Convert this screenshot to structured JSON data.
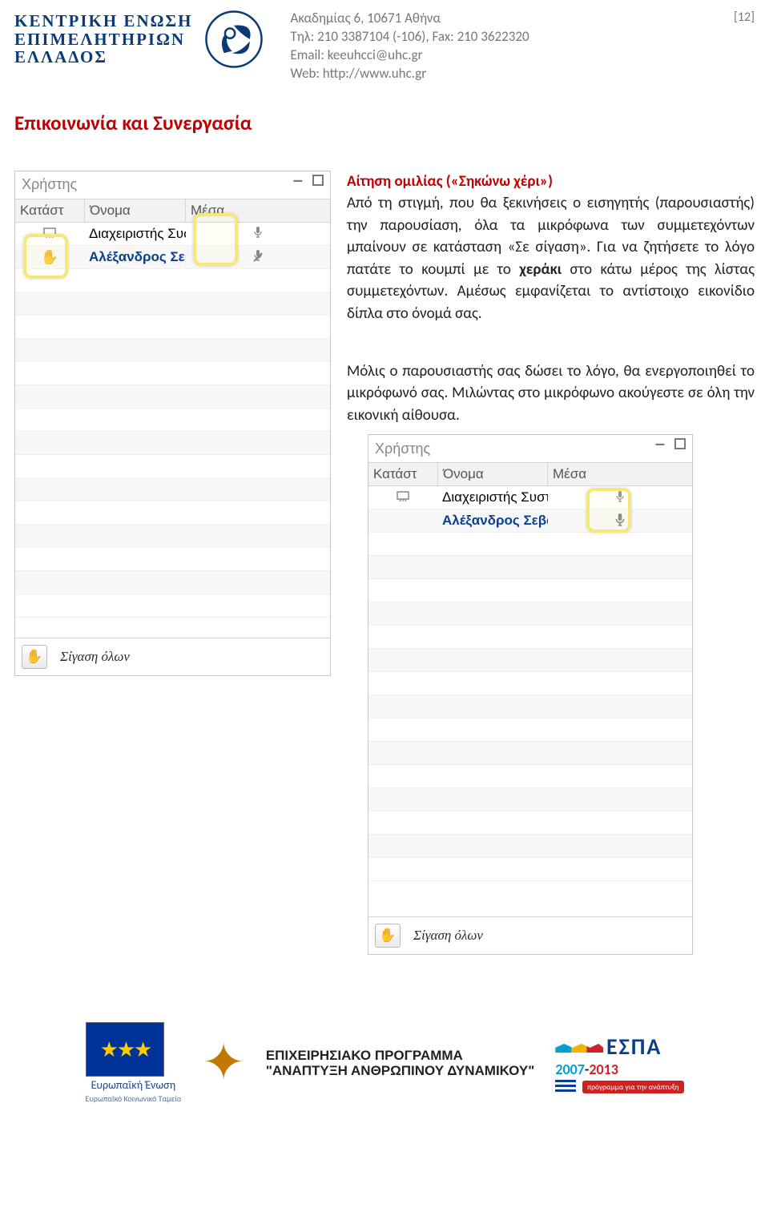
{
  "meta": {
    "page_number_label": "[12]"
  },
  "org": {
    "name_line1": "ΚΕΝΤΡΙΚΗ ΕΝΩΣΗ",
    "name_line2": "ΕΠΙΜΕΛΗΤΗΡΙΩΝ",
    "name_line3": "ΕΛΛΑΔΟΣ",
    "address": "Ακαδημίας 6, 10671 Αθήνα",
    "phone_fax": "Τηλ: 210 3387104 (-106), Fax: 210 3622320",
    "email": "Email: keeuhcci@uhc.gr",
    "web": "Web: http://www.uhc.gr"
  },
  "section_title": "Επικοινωνία και Συνεργασία",
  "content_title": "Αίτηση ομιλίας («Σηκώνω χέρι»)",
  "paragraph1_a": "Από τη στιγμή, που θα ξεκινήσεις ο εισηγητής (παρουσιαστής) την παρουσίαση, όλα τα μικρόφωνα των συμμετεχόντων μπαίνουν σε κατάσταση «Σε σίγαση». Για να ζητήσετε το λόγο πατάτε το κουμπί με το ",
  "hand_word": "χεράκι",
  "paragraph1_b": " στο κάτω μέρος της λίστας συμμετεχόντων. Αμέσως εμφανίζεται το αντίστοιχο εικονίδιο δίπλα στο όνομά σας.",
  "paragraph2": "Μόλις ο παρουσιαστής σας δώσει το λόγο, θα ενεργοποιηθεί το μικρόφωνό σας. Μιλώντας στο μικρόφωνο ακούγεστε σε όλη την εικονική αίθουσα.",
  "panel": {
    "title": "Χρήστης",
    "col_status": "Κατάστ",
    "col_name": "Όνομα",
    "col_media": "Μέσα",
    "user1": "Διαχειριστής Συστήμα",
    "user2": "Αλέξανδρος Σεβασ",
    "user2b": "Αλέξανδρος Σεβαστ",
    "footer": "Σίγαση όλων"
  },
  "footer_logos": {
    "eu_caption": "Ευρωπαϊκή Ένωση",
    "eu_sub": "Ευρωπαϊκό Κοινωνικό Ταμείο",
    "oper_program_l1": "ΕΠΙΧΕΙΡΗΣΙΑΚΟ ΠΡΟΓΡΑΜΜΑ",
    "oper_program_l2": "\"ΑΝΑΠΤΥΞΗ ΑΝΘΡΩΠΙΝΟΥ ΔΥΝΑΜΙΚΟΥ\"",
    "espa_title": "ΕΣΠΑ",
    "espa_years_1": "2007",
    "espa_years_dash": "-",
    "espa_years_2": "2013",
    "espa_sub": "πρόγραμμα για την ανάπτυξη"
  }
}
